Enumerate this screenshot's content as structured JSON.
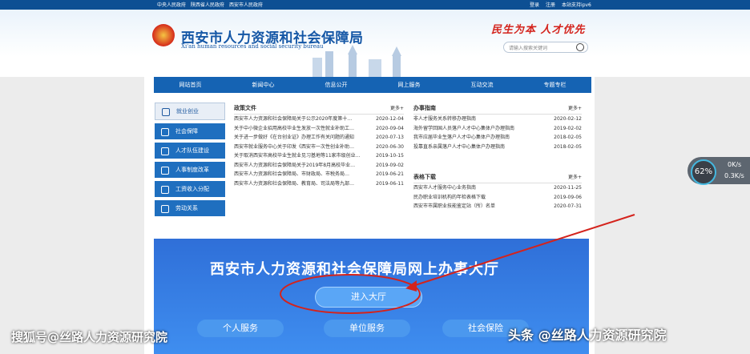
{
  "topbar": {
    "links": [
      "中央人民政府",
      "陕西省人民政府",
      "西安市人民政府"
    ],
    "right": [
      "登录",
      "注册",
      "本站支持ipv6"
    ]
  },
  "header": {
    "title_cn": "西安市人力资源和社会保障局",
    "title_en": "Xi'an human resources and social security bureau",
    "slogan": "民生为本 人才优先",
    "search_placeholder": "请输入搜索关键词"
  },
  "nav": [
    "网站首页",
    "新闻中心",
    "信息公开",
    "网上服务",
    "互动交流",
    "专题专栏"
  ],
  "sidebar": [
    "就业创业",
    "社会保障",
    "人才队伍建设",
    "人事制度改革",
    "工资收入分配",
    "劳动关系"
  ],
  "policy": {
    "title": "政策文件",
    "more": "更多+",
    "rows": [
      {
        "text": "西安市人力资源和社会保障局关于公示2020年度第十…",
        "date": "2020-12-04"
      },
      {
        "text": "关于中小微企业招用高校毕业生发放一次性就业补助工…",
        "date": "2020-09-04"
      },
      {
        "text": "关于进一步做好《在台创业证》办理工作有关问题的通知",
        "date": "2020-07-13"
      },
      {
        "text": "西安市就业服务中心关于印发《西安市一次性创业补助…",
        "date": "2020-06-30"
      },
      {
        "text": "关于取消西安市高校毕业生就业见习基地等11家市级创业…",
        "date": "2019-10-15"
      },
      {
        "text": "西安市人力资源和社会保障局关于2019年8月高校毕业…",
        "date": "2019-09-02"
      },
      {
        "text": "西安市人力资源和社会保障局、市财政局、市税务局…",
        "date": "2019-06-21"
      },
      {
        "text": "西安市人力资源和社会保障局、教育局、司法局等九部…",
        "date": "2019-06-11"
      }
    ]
  },
  "guide": {
    "title": "办事指南",
    "more": "更多+",
    "rows": [
      {
        "text": "非人才服务关系转移办理指南",
        "date": "2020-02-12"
      },
      {
        "text": "海外留学回国人员落户人才中心集体户办理指南",
        "date": "2019-02-02"
      },
      {
        "text": "我市应届毕业生落户人才中心集体户办理指南",
        "date": "2018-02-05"
      },
      {
        "text": "投靠直系亲属落户人才中心集体户办理指南",
        "date": "2018-02-05"
      }
    ]
  },
  "download": {
    "title": "表格下载",
    "more": "更多+",
    "rows": [
      {
        "text": "西安市人才服务中心业务指南",
        "date": "2020-11-25"
      },
      {
        "text": "民办职业培训机构的年检表格下载",
        "date": "2019-09-06"
      },
      {
        "text": "西安市市属职业技能鉴定站（所）名单",
        "date": "2020-07-31"
      }
    ]
  },
  "hall": {
    "title": "西安市人力资源和社会保障局网上办事大厅",
    "enter": "进入大厅",
    "services": [
      "个人服务",
      "单位服务",
      "社会保险"
    ]
  },
  "badge": {
    "percent": "62%",
    "up": "0K/s",
    "down": "0.3K/s"
  },
  "watermarks": {
    "left": "搜狐号@丝路人力资源研究院",
    "right": "头条 @丝路人力资源研究院"
  },
  "colors": {
    "brand_blue": "#1563b3",
    "hall_blue": "#2f6fd8",
    "arrow_red": "#d4231c"
  }
}
